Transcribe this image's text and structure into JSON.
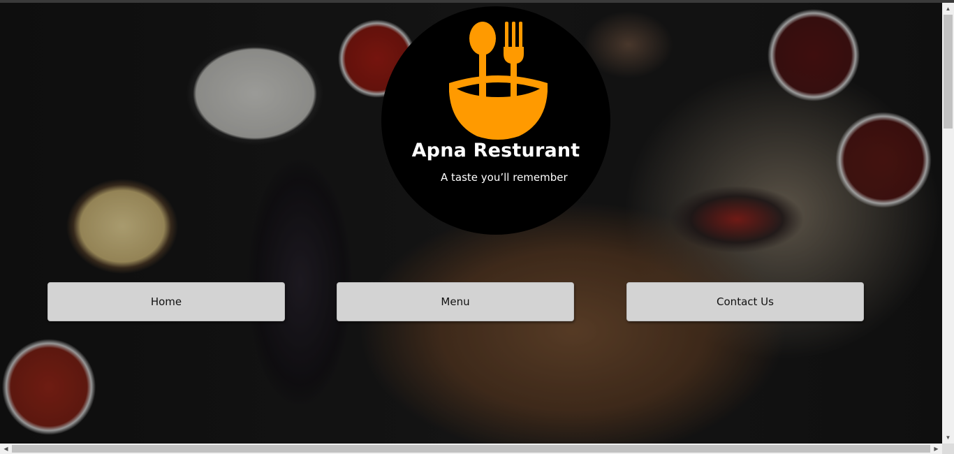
{
  "brand": {
    "name": "Apna Resturant",
    "tagline": "A taste you’ll remember",
    "logo_icon": "bowl-spoon-fork-icon",
    "logo_color": "#FF9A00",
    "disc_color": "#000000"
  },
  "nav": {
    "items": [
      {
        "label": "Home"
      },
      {
        "label": "Menu"
      },
      {
        "label": "Contact Us"
      }
    ],
    "button_color": "#D3D3D3"
  },
  "background": {
    "image": "grilled-food-platter-background"
  }
}
